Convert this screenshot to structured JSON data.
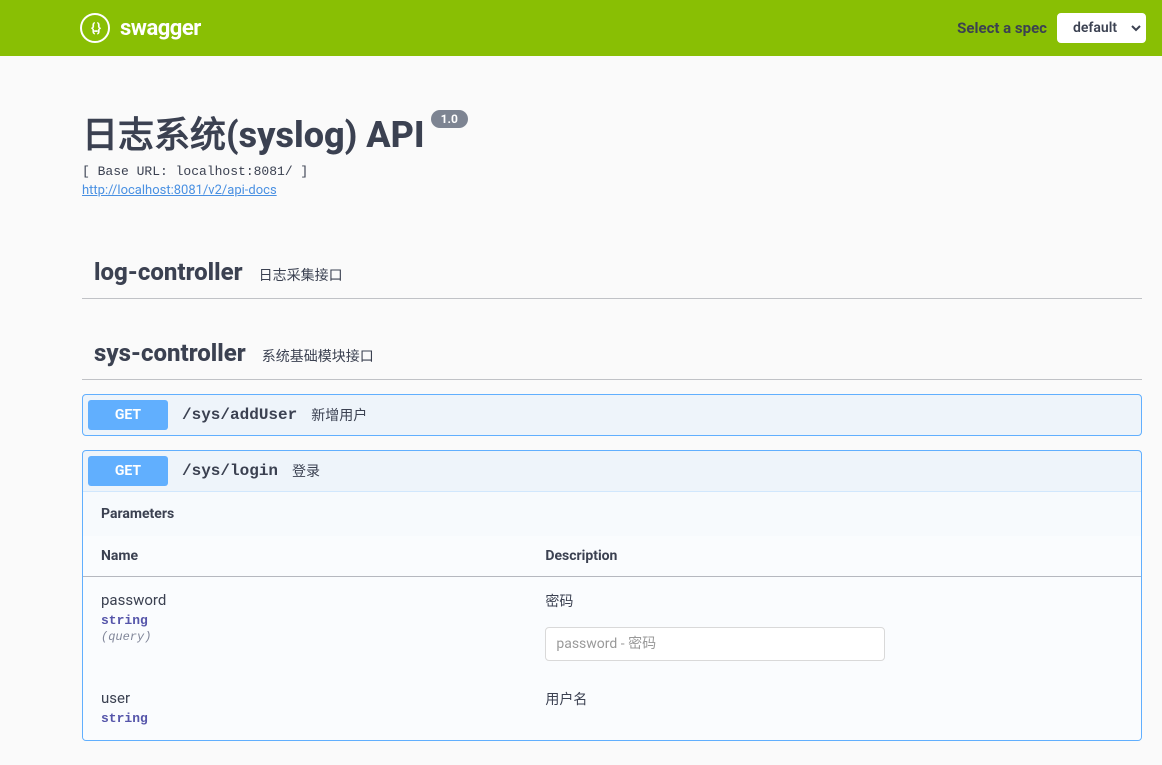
{
  "topbar": {
    "brand": "swagger",
    "select_label": "Select a spec",
    "spec_value": "default"
  },
  "info": {
    "title": "日志系统(syslog) API",
    "version": "1.0",
    "base_url_text": "[ Base URL: localhost:8081/ ]",
    "docs_link": "http://localhost:8081/v2/api-docs"
  },
  "tags": [
    {
      "name": "log-controller",
      "description": "日志采集接口"
    },
    {
      "name": "sys-controller",
      "description": "系统基础模块接口"
    }
  ],
  "operations": {
    "sys": [
      {
        "method": "GET",
        "path": "/sys/addUser",
        "summary": "新增用户",
        "expanded": false
      },
      {
        "method": "GET",
        "path": "/sys/login",
        "summary": "登录",
        "expanded": true,
        "params_section_title": "Parameters",
        "table_headers": {
          "name": "Name",
          "description": "Description"
        },
        "parameters": [
          {
            "name": "password",
            "type": "string",
            "in": "(query)",
            "description": "密码",
            "placeholder": "password - 密码"
          },
          {
            "name": "user",
            "type": "string",
            "in": "",
            "description": "用户名",
            "placeholder": ""
          }
        ]
      }
    ]
  }
}
